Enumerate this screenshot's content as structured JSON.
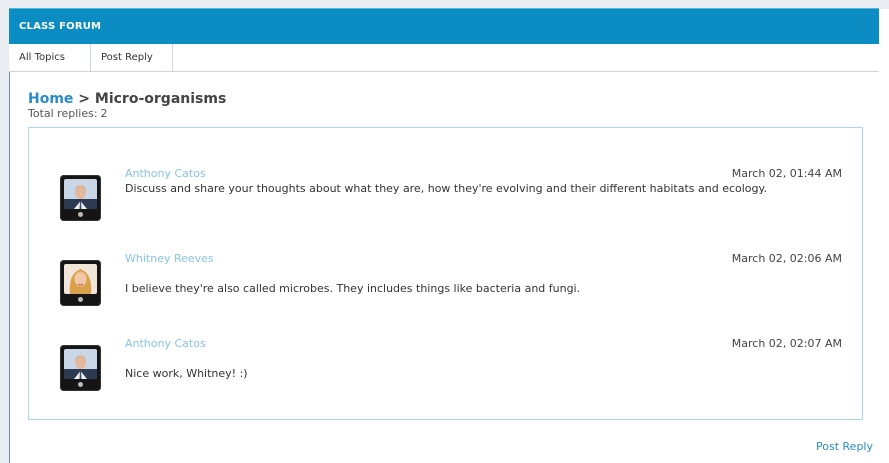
{
  "header": {
    "title": "CLASS FORUM"
  },
  "tabs": [
    {
      "label": "All Topics"
    },
    {
      "label": "Post Reply"
    }
  ],
  "breadcrumb": {
    "home": "Home",
    "separator": ">",
    "topic": "Micro-organisms"
  },
  "summary": {
    "label": "Total replies:",
    "count": "2"
  },
  "posts": [
    {
      "author": "Anthony Catos",
      "time": "March 02, 01:44 AM",
      "message": "Discuss and share your thoughts about what they are, how they're evolving and their different habitats and ecology.",
      "avatar": "man-avatar"
    },
    {
      "author": "Whitney Reeves",
      "time": "March 02, 02:06 AM",
      "message": "I believe they're also called microbes. They includes things like bacteria and fungi.",
      "avatar": "woman-avatar"
    },
    {
      "author": "Anthony Catos",
      "time": "March 02, 02:07 AM",
      "message": "Nice work, Whitney! :)",
      "avatar": "man-avatar"
    }
  ],
  "footer": {
    "post_reply": "Post Reply"
  },
  "colors": {
    "header": "#0b8dc4",
    "link": "#2a8bc6",
    "author": "#87c3e4",
    "panel_border": "#a9d6e9"
  }
}
